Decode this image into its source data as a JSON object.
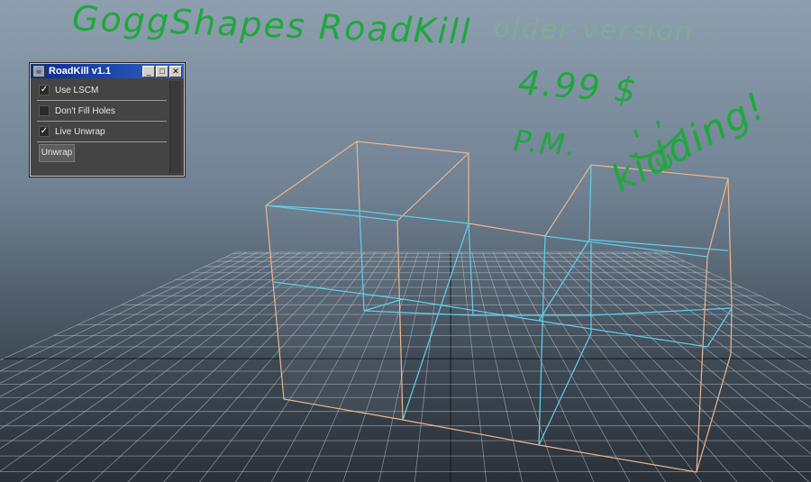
{
  "window": {
    "title": "RoadKill v1.1",
    "app_icon": "roadkill-icon",
    "controls": {
      "minimize": "_",
      "maximize": "□",
      "close": "✕"
    },
    "options": [
      {
        "label": "Use LSCM",
        "checked": true,
        "check_mark": "✓"
      },
      {
        "label": "Don't Fill Holes",
        "checked": false,
        "check_mark": ""
      },
      {
        "label": "Live Unwrap",
        "checked": true,
        "check_mark": "✓"
      }
    ],
    "unwrap_label": "Unwrap"
  },
  "annotations": {
    "title": "GoggShapes RoadKill",
    "older_version": "older version",
    "price": "4.99 $",
    "pm": "P.M.",
    "kidding": "kidding!"
  },
  "colors": {
    "handwriting": "#1fa83c",
    "edge_outline": "#f0b58a",
    "edge_inner": "#5fd0ee",
    "grid": "#c9ced3"
  }
}
